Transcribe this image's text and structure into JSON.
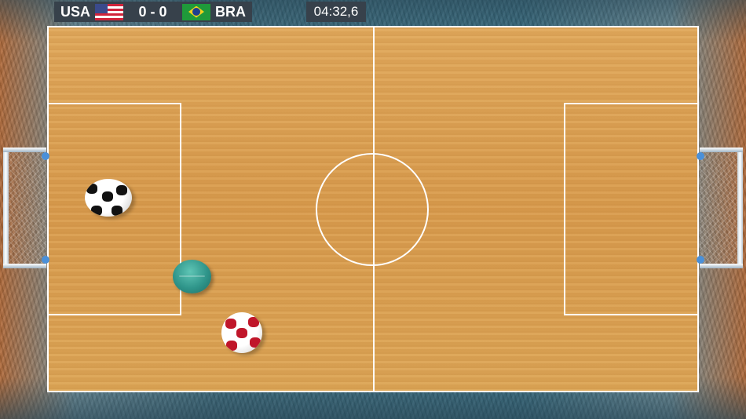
{
  "hud": {
    "home_team": "USA",
    "home_flag": "usa-flag-icon",
    "score": "0 - 0",
    "away_team": "BRA",
    "away_flag": "brazil-flag-icon",
    "timer": "04:32,6"
  },
  "colors": {
    "court": "#d89b4e",
    "lines": "#ffffff",
    "hud_bg": "#37414b",
    "goal_joint": "#4a90d9",
    "player_puck": "#2f958a",
    "ball_patch_black": "#111111",
    "ball_patch_red": "#c0162a"
  },
  "game_objects": {
    "balls": [
      "black-white-ball",
      "red-white-ball"
    ],
    "player": "teal-puck"
  }
}
